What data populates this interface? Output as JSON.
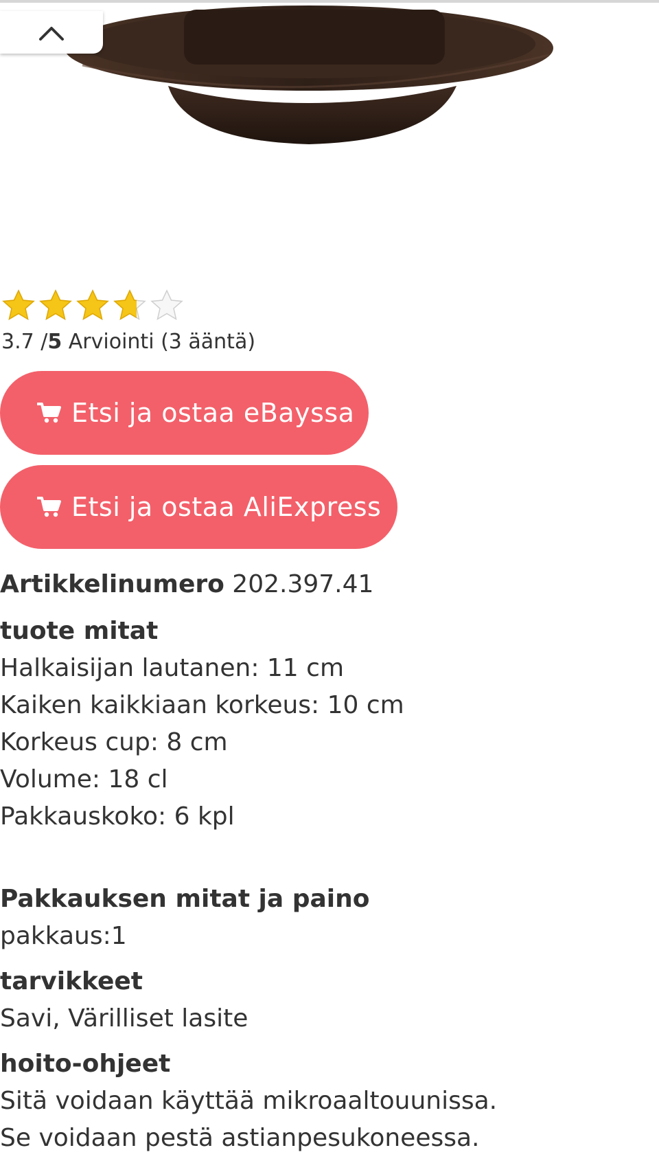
{
  "rating": {
    "value": "3.7",
    "separator": " /",
    "max": "5",
    "label": " Arviointi (3 ääntä)",
    "stars_filled_fraction": 0.74,
    "star_count": 5,
    "star_color": "#f5c518"
  },
  "buttons": {
    "ebay_label": "Etsi ja ostaa eBayssa",
    "aliexpress_label": "Etsi ja ostaa AliExpress",
    "icon": "shopping-cart-icon",
    "color": "#f3606a"
  },
  "details": {
    "article_label": "Artikkelinumero",
    "article_number": " 202.397.41",
    "dimensions_heading": "tuote mitat",
    "dimensions": [
      "Halkaisijan lautanen: 11 cm",
      "Kaiken kaikkiaan korkeus: 10 cm",
      "Korkeus cup: 8 cm",
      "Volume: 18 cl",
      "Pakkauskoko: 6 kpl"
    ],
    "package_heading": "Pakkauksen mitat ja paino",
    "package_value": "pakkaus:1",
    "materials_heading": "tarvikkeet",
    "materials_value": "Savi, Värilliset lasite",
    "care_heading": "hoito-ohjeet",
    "care_lines": [
      "Sitä voidaan käyttää mikroaaltouunissa.",
      "Se voidaan pestä astianpesukoneessa."
    ]
  },
  "icons": {
    "collapse": "chevron-up-icon",
    "star": "star-icon"
  }
}
